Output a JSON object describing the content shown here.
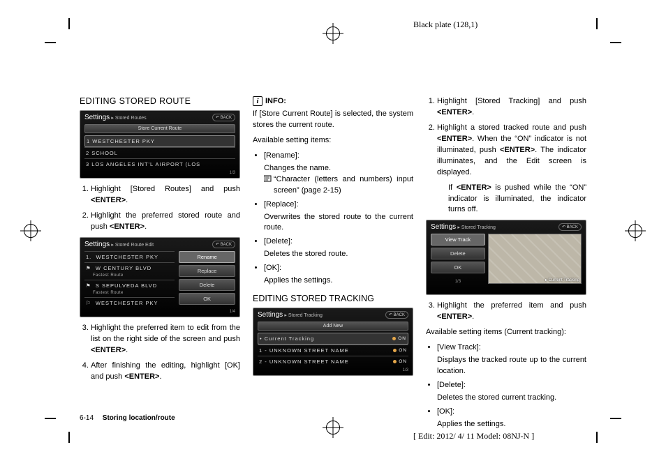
{
  "plate": "Black plate (128,1)",
  "edit_info": "[ Edit: 2012/ 4/ 11   Model:  08NJ-N ]",
  "footer": {
    "page": "6-14",
    "section": "Storing location/route"
  },
  "col1": {
    "heading": "EDITING STORED ROUTE",
    "screen1": {
      "title": "Settings",
      "crumb": "▸ Stored Routes",
      "back": "↶ BACK",
      "bar": "Store Current Route",
      "items": [
        "1  WESTCHESTER PKY",
        "2  SCHOOL",
        "3  LOS ANGELES INT'L AIRPORT (LOS"
      ],
      "footer": "1/3"
    },
    "steps1": [
      "Highlight [Stored Routes] and push <ENTER>.",
      "Highlight the preferred stored route and push <ENTER>."
    ],
    "screen2": {
      "title": "Settings",
      "crumb": "▸ Stored Route Edit",
      "back": "↶ BACK",
      "left_items": [
        {
          "n": "1.",
          "t": "WESTCHESTER PKY"
        },
        {
          "n": "⚑",
          "t": "W CENTURY BLVD",
          "sub": "Fastest Route"
        },
        {
          "n": "⚑",
          "t": "S SEPULVEDA BLVD",
          "sub": "Fastest Route"
        },
        {
          "n": "⚐",
          "t": "WESTCHESTER PKY"
        }
      ],
      "right_buttons": [
        "Rename",
        "Replace",
        "Delete",
        "OK"
      ],
      "footer": "1/4"
    },
    "steps2": [
      "Highlight the preferred item to edit from the list on the right side of the screen and push <ENTER>.",
      "After finishing the editing, highlight [OK] and push <ENTER>."
    ]
  },
  "col2": {
    "info_label": "INFO:",
    "info_body": "If [Store Current Route] is selected, the system stores the current route.",
    "avail_label": "Available setting items:",
    "bullets": [
      {
        "t": "[Rename]:",
        "b": "Changes the name.",
        "ref": "“Character (letters and numbers) input screen” (page 2-15)"
      },
      {
        "t": "[Replace]:",
        "b": "Overwrites the stored route to the current route."
      },
      {
        "t": "[Delete]:",
        "b": "Deletes the stored route."
      },
      {
        "t": "[OK]:",
        "b": "Applies the settings."
      }
    ],
    "heading2": "EDITING STORED TRACKING",
    "screen": {
      "title": "Settings",
      "crumb": "▸ Stored Tracking",
      "back": "↶ BACK",
      "bar": "Add New",
      "items": [
        {
          "t": "• Current Tracking",
          "on": "ON"
        },
        {
          "t": "1 - UNKNOWN STREET NAME",
          "on": "ON"
        },
        {
          "t": "2 - UNKNOWN STREET NAME",
          "on": "ON"
        }
      ],
      "footer": "1/3"
    }
  },
  "col3": {
    "steps1": [
      "Highlight [Stored Tracking] and push <ENTER>.",
      "Highlight a stored tracked route and push <ENTER>. When the “ON” indicator is not illuminated, push <ENTER>. The indicator illuminates, and the Edit screen is displayed."
    ],
    "note": "If <ENTER> is pushed while the “ON” indicator is illuminated, the indicator turns off.",
    "screen": {
      "title": "Settings",
      "crumb": "▸ Stored Tracking",
      "back": "↶ BACK",
      "menu": [
        "View Track",
        "Delete",
        "OK"
      ],
      "footer": "1/3",
      "map_label": "▸ Current Tracking"
    },
    "steps2": [
      "Highlight the preferred item and push <ENTER>."
    ],
    "avail_label": "Available setting items (Current tracking):",
    "bullets": [
      {
        "t": "[View Track]:",
        "b": "Displays the tracked route up to the current location."
      },
      {
        "t": "[Delete]:",
        "b": "Deletes the stored current tracking."
      },
      {
        "t": "[OK]:",
        "b": "Applies the settings."
      }
    ]
  }
}
